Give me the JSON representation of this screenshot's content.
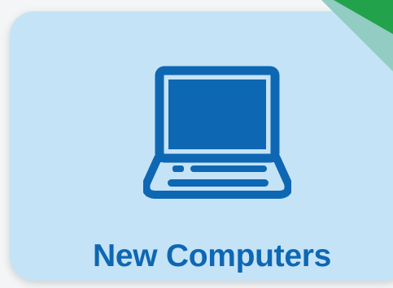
{
  "tile": {
    "label": "New Computers",
    "icon": "laptop-icon",
    "accent_color": "#0e67b3",
    "background_color": "#c5e3f6",
    "corner_colors": [
      "#92ccc2",
      "#22a24a"
    ]
  }
}
